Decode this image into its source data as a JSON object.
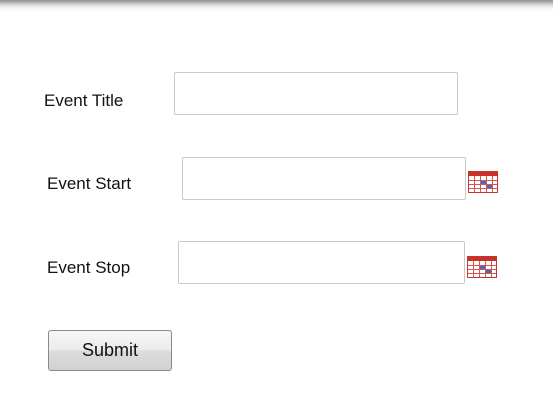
{
  "form": {
    "event_title": {
      "label": "Event Title",
      "value": ""
    },
    "event_start": {
      "label": "Event Start",
      "value": ""
    },
    "event_stop": {
      "label": "Event Stop",
      "value": ""
    },
    "submit_label": "Submit"
  },
  "icons": {
    "calendar": "calendar-icon"
  },
  "colors": {
    "calendar_red": "#d9534f",
    "calendar_blue": "#3b6fc6",
    "field_border": "#c9c9c9"
  }
}
